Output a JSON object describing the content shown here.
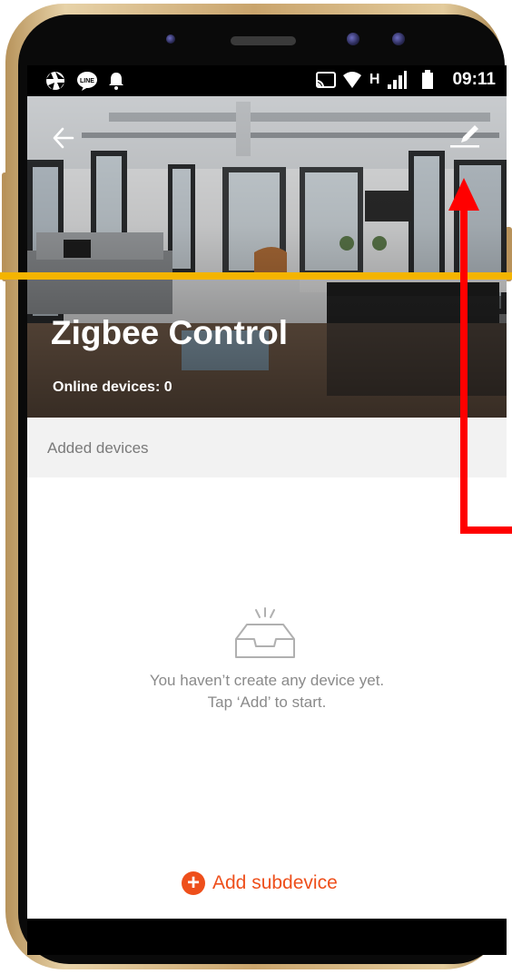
{
  "status_bar": {
    "time": "09:11",
    "network_type": "H",
    "left_icons": [
      "aperture-icon",
      "line-chat-icon",
      "notification-bell-icon"
    ],
    "right_icons": [
      "cast-icon",
      "wifi-icon",
      "signal-icon",
      "battery-icon"
    ]
  },
  "header": {
    "back_icon": "arrow-left-icon",
    "edit_icon": "pencil-icon",
    "title": "Zigbee Control",
    "online_devices": "Online devices: 0"
  },
  "section": {
    "label": "Added devices"
  },
  "empty_state": {
    "icon": "empty-tray-icon",
    "line1": "You haven’t create any device yet.",
    "line2": "Tap ‘Add’ to start."
  },
  "add_button": {
    "icon": "plus-circle-icon",
    "label": "Add subdevice"
  },
  "colors": {
    "accent": "#ee4f1b",
    "annotation_yellow": "#f4b400",
    "annotation_red": "#ff0000",
    "section_bg": "#f2f2f2"
  }
}
